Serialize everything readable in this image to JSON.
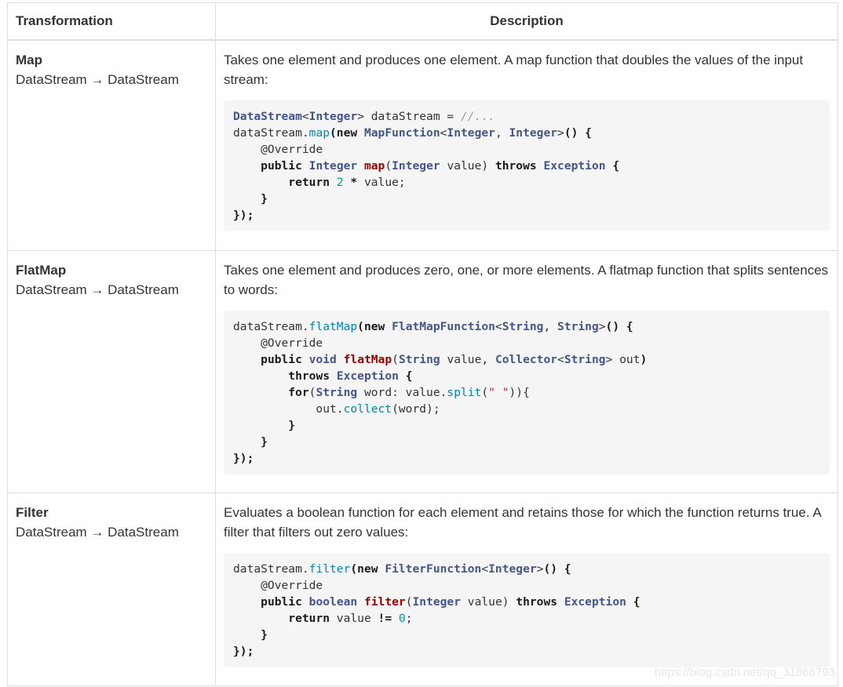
{
  "table": {
    "headers": {
      "transformation": "Transformation",
      "description": "Description"
    },
    "rows": [
      {
        "name": "Map",
        "signature": "DataStream → DataStream",
        "description": "Takes one element and produces one element. A map function that doubles the values of the input stream:"
      },
      {
        "name": "FlatMap",
        "signature": "DataStream → DataStream",
        "description": "Takes one element and produces zero, one, or more elements. A flatmap function that splits sentences to words:"
      },
      {
        "name": "Filter",
        "signature": "DataStream → DataStream",
        "description": "Evaluates a boolean function for each element and retains those for which the function returns true. A filter that filters out zero values:"
      }
    ]
  },
  "watermark": "https://blog.csdn.net/qq_31866793"
}
